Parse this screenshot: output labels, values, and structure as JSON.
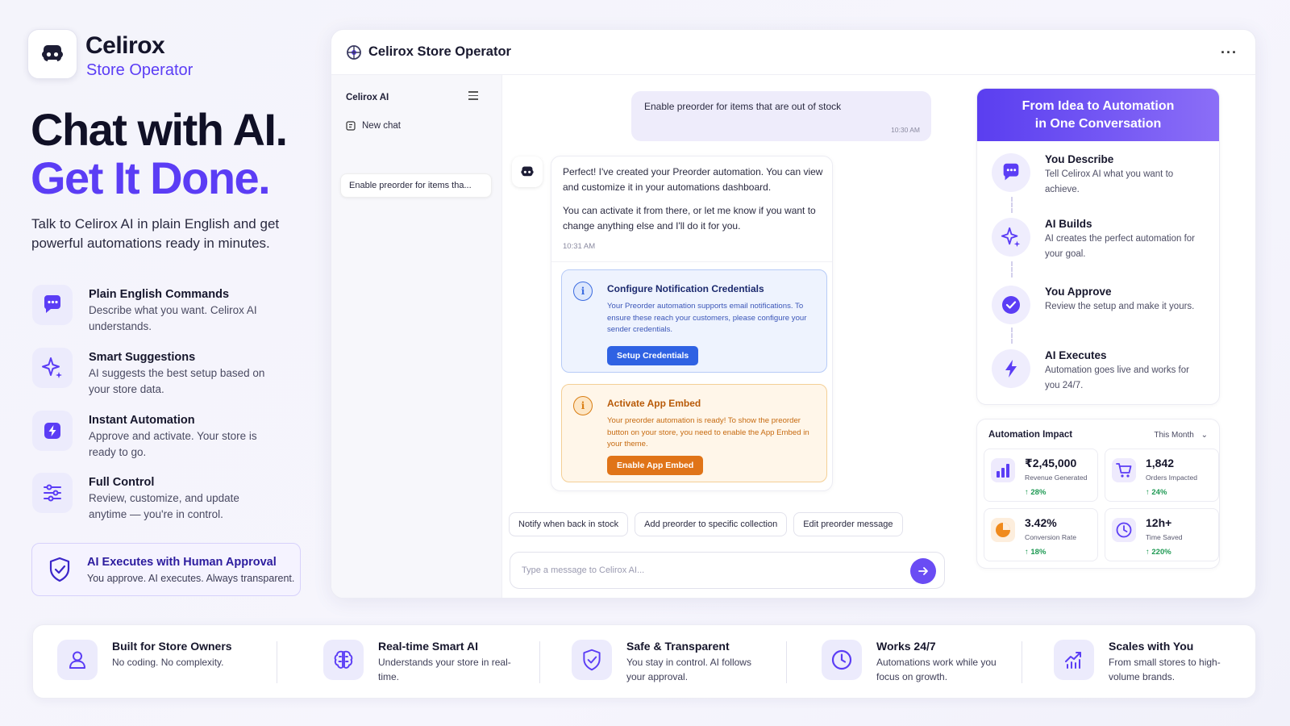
{
  "brand": {
    "name": "Celirox",
    "subtitle": "Store Operator"
  },
  "hero": {
    "line1": "Chat with AI.",
    "line2": "Get It Done.",
    "description": "Talk to Celirox AI in plain English and get powerful automations ready in minutes."
  },
  "features": [
    {
      "icon": "chat-bubble-icon",
      "title": "Plain English Commands",
      "description": "Describe what you want. Celirox AI understands."
    },
    {
      "icon": "sparkle-icon",
      "title": "Smart Suggestions",
      "description": "AI suggests the best setup based on your store data."
    },
    {
      "icon": "lightning-icon",
      "title": "Instant Automation",
      "description": "Approve and activate. Your store is ready to go."
    },
    {
      "icon": "sliders-icon",
      "title": "Full Control",
      "description": "Review, customize, and update anytime — you're in control."
    }
  ],
  "approval": {
    "icon": "shield-check-icon",
    "title": "AI Executes with Human Approval",
    "description": "You approve. AI executes. Always transparent."
  },
  "app": {
    "title": "Celirox Store Operator",
    "more_label": "···",
    "sidebar": {
      "heading": "Celirox AI",
      "new_chat": "New chat",
      "history": [
        "Enable preorder for items tha..."
      ]
    },
    "chat": {
      "user_message": {
        "text": "Enable preorder for items that are out of stock",
        "time": "10:30 AM"
      },
      "bot_message": {
        "paragraph1": "Perfect! I've created your Preorder automation. You can view and customize it in your automations dashboard.",
        "paragraph2": "You can activate it from there, or let me know if you want to change anything else and I'll do it for you.",
        "time": "10:31 AM",
        "config_card": {
          "title": "Configure Notification Credentials",
          "description": "Your Preorder automation supports email notifications. To ensure these reach your customers, please configure your sender credentials.",
          "button": "Setup Credentials"
        },
        "activate_card": {
          "title": "Activate App Embed",
          "description": "Your preorder automation is ready! To show the preorder button on your store, you need to enable the App Embed in your theme.",
          "button": "Enable App Embed"
        }
      },
      "suggestions": [
        "Notify when back in stock",
        "Add preorder to specific collection",
        "Edit preorder message"
      ],
      "input_placeholder": "Type a message to Celirox AI..."
    },
    "steps": {
      "heading_line1": "From Idea to Automation",
      "heading_line2": "in One Conversation",
      "items": [
        {
          "icon": "chat-bubble-icon",
          "title": "You Describe",
          "description": "Tell Celirox AI what you want to achieve."
        },
        {
          "icon": "sparkle-icon",
          "title": "AI Builds",
          "description": "AI creates the perfect automation for your goal."
        },
        {
          "icon": "check-circle-icon",
          "title": "You Approve",
          "description": "Review the setup and make it yours."
        },
        {
          "icon": "lightning-icon",
          "title": "AI Executes",
          "description": "Automation goes live and works for you 24/7."
        }
      ]
    },
    "impact": {
      "title": "Automation Impact",
      "period": "This Month",
      "metrics": [
        {
          "icon": "bar-chart-icon",
          "value": "₹2,45,000",
          "label": "Revenue Generated",
          "delta": "↑ 28%"
        },
        {
          "icon": "cart-icon",
          "value": "1,842",
          "label": "Orders Impacted",
          "delta": "↑ 24%"
        },
        {
          "icon": "pie-chart-icon",
          "value": "3.42%",
          "label": "Conversion Rate",
          "delta": "↑ 18%"
        },
        {
          "icon": "clock-icon",
          "value": "12h+",
          "label": "Time Saved",
          "delta": "↑ 220%"
        }
      ]
    }
  },
  "benefits": [
    {
      "icon": "user-icon",
      "title": "Built for Store Owners",
      "description": "No coding. No complexity."
    },
    {
      "icon": "brain-icon",
      "title": "Real-time Smart AI",
      "description": "Understands your store in real-time."
    },
    {
      "icon": "shield-check-icon",
      "title": "Safe & Transparent",
      "description": "You stay in control. AI follows your approval."
    },
    {
      "icon": "clock-icon",
      "title": "Works 24/7",
      "description": "Automations work while you focus on growth."
    },
    {
      "icon": "growth-chart-icon",
      "title": "Scales with You",
      "description": "From small stores to high-volume brands."
    }
  ],
  "colors": {
    "accent": "#5b3df5",
    "info_blue": "#2f62e3",
    "warning_orange": "#e07418",
    "success_green": "#1f9a54"
  }
}
